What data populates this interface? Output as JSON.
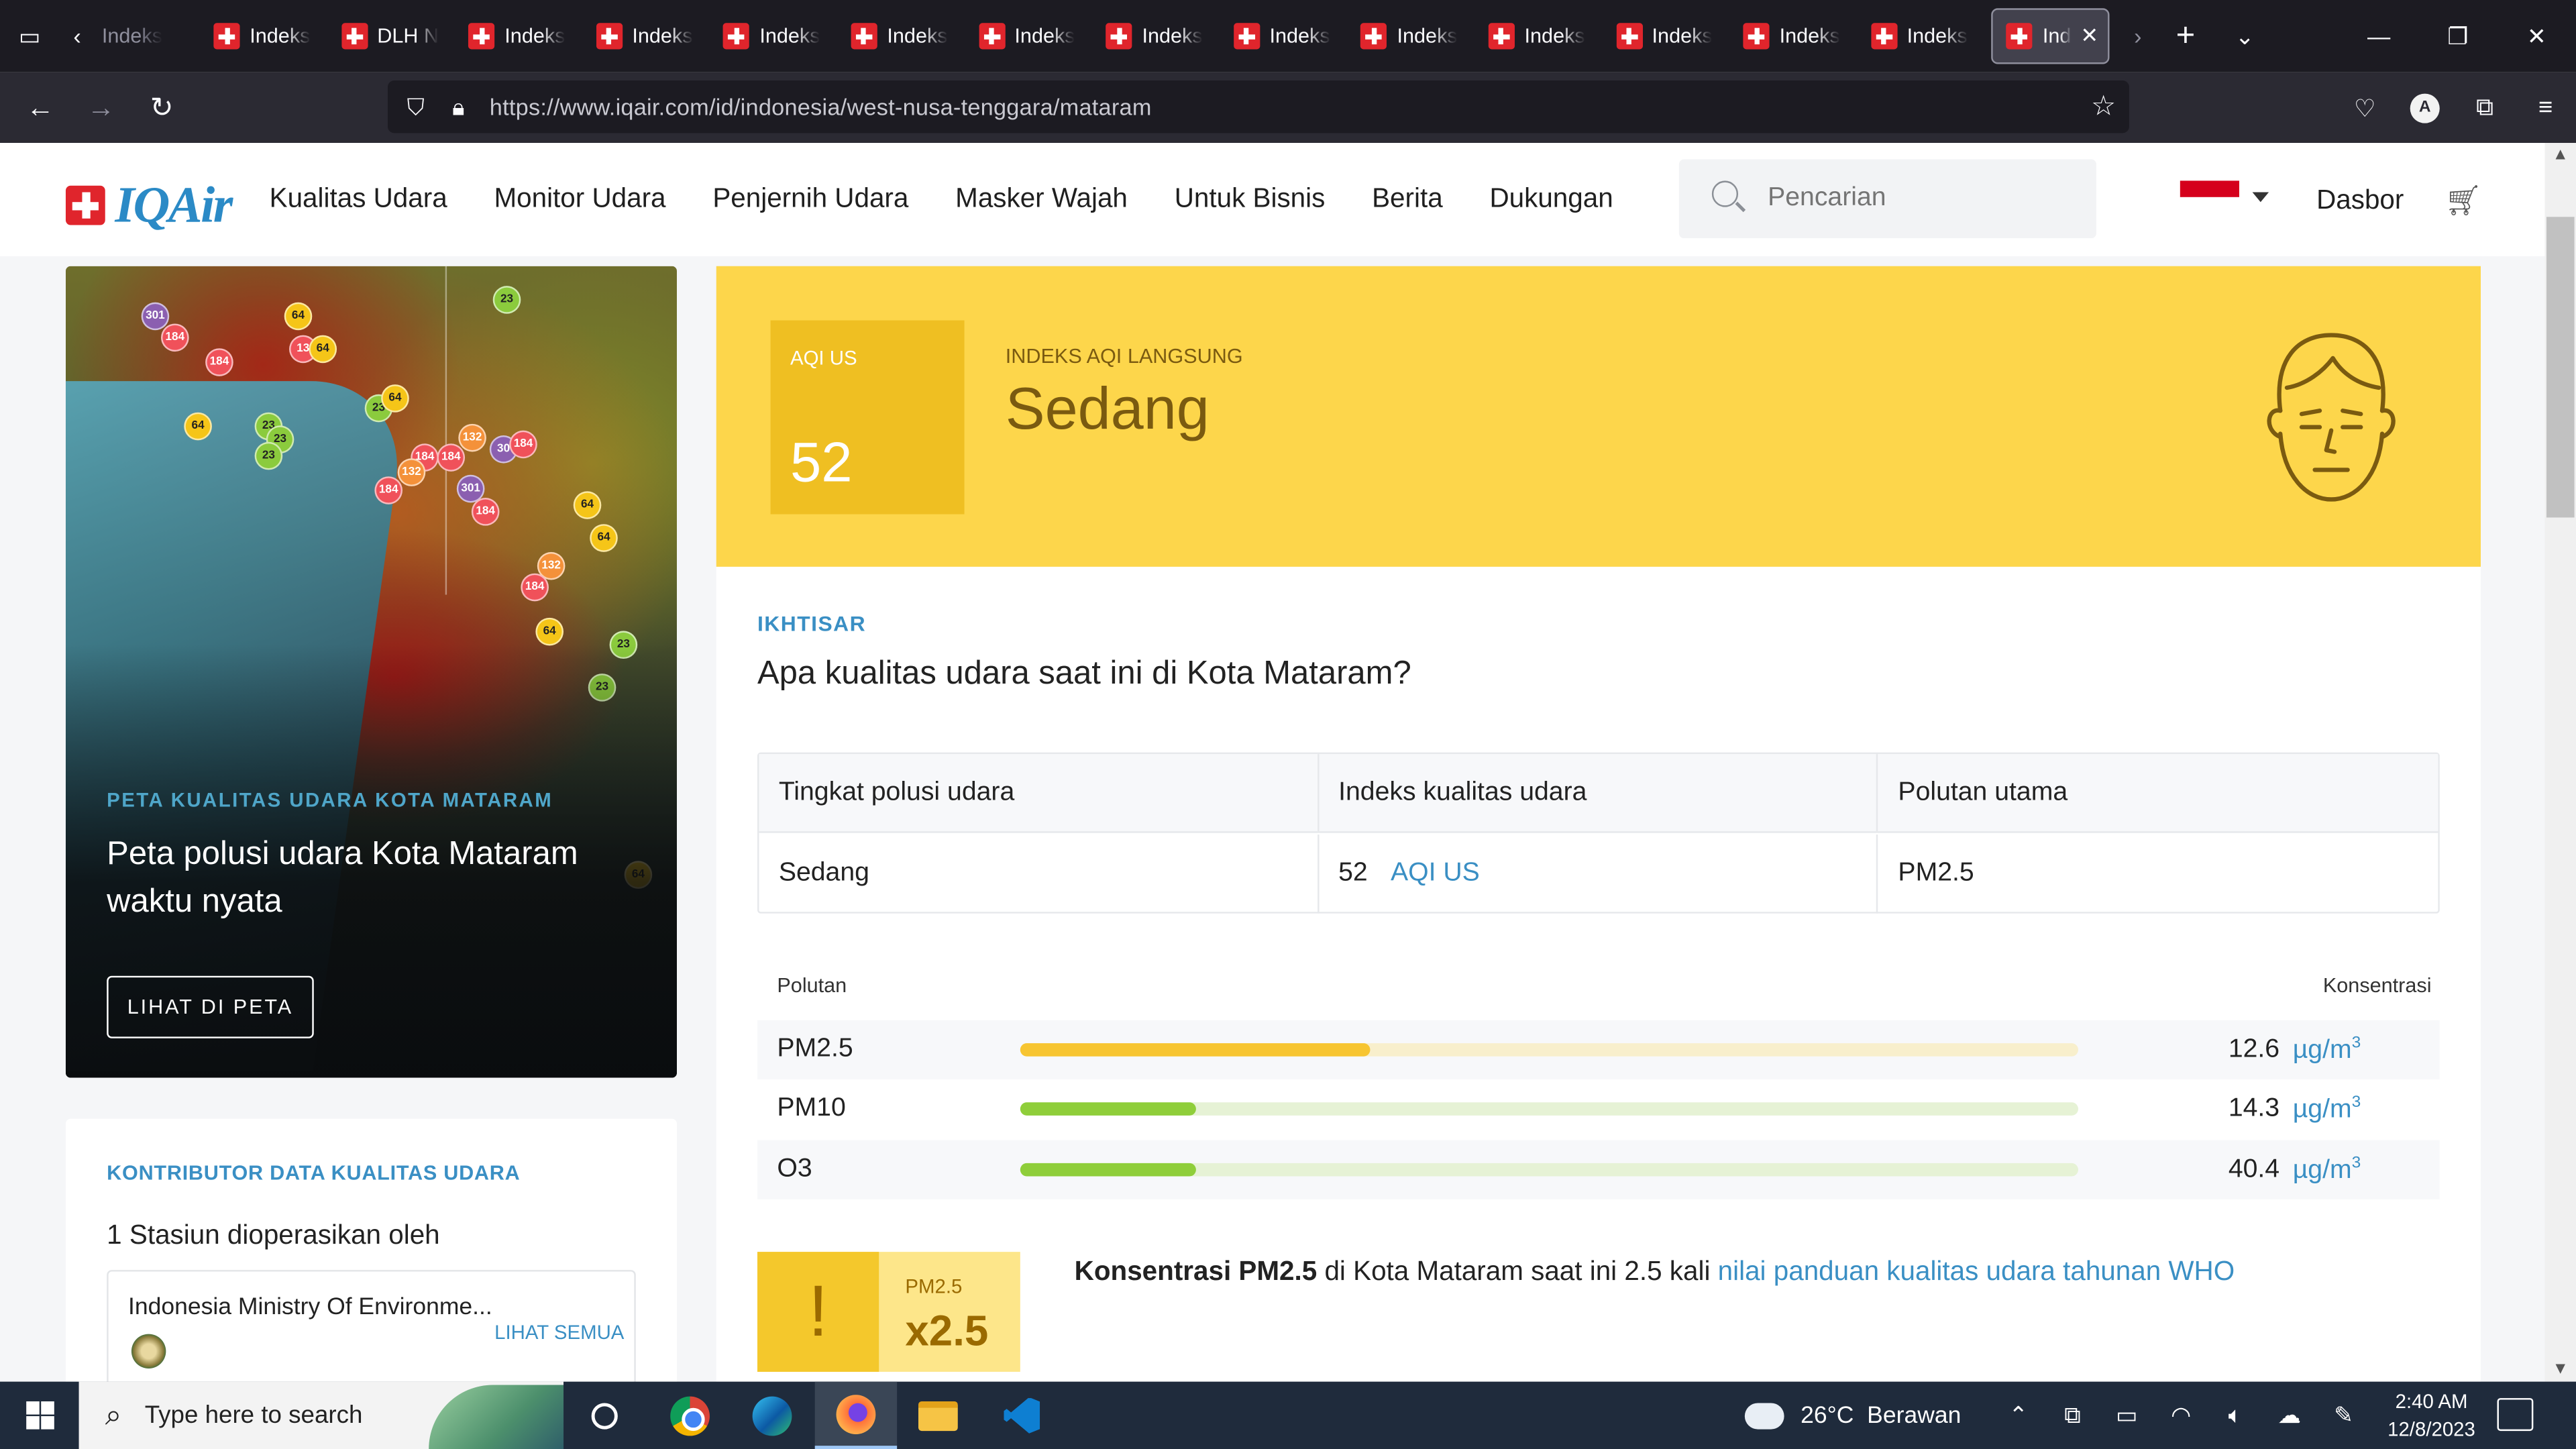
{
  "browser": {
    "tabs": [
      {
        "label": "Indeks"
      },
      {
        "label": "Indeks"
      },
      {
        "label": "DLH N"
      },
      {
        "label": "Indeks"
      },
      {
        "label": "Indeks"
      },
      {
        "label": "Indeks"
      },
      {
        "label": "Indeks"
      },
      {
        "label": "Indeks"
      },
      {
        "label": "Indeks"
      },
      {
        "label": "Indeks"
      },
      {
        "label": "Indeks"
      },
      {
        "label": "Indeks"
      },
      {
        "label": "Indeks"
      },
      {
        "label": "Indeks"
      },
      {
        "label": "Indeks"
      },
      {
        "label": "Ind",
        "active": true
      }
    ],
    "url": "https://www.iqair.com/id/indonesia/west-nusa-tenggara/mataram",
    "account_initial": "A"
  },
  "header": {
    "logo": "IQAir",
    "nav": [
      "Kualitas Udara",
      "Monitor Udara",
      "Penjernih Udara",
      "Masker Wajah",
      "Untuk Bisnis",
      "Berita",
      "Dukungan"
    ],
    "search_placeholder": "Pencarian",
    "dashboard": "Dasbor"
  },
  "map_card": {
    "kicker": "PETA KUALITAS UDARA KOTA MATARAM",
    "title": "Peta polusi udara Kota Mataram waktu nyata",
    "button": "LIHAT DI PETA",
    "markers": [
      "301",
      "184",
      "184",
      "64",
      "13",
      "64",
      "64",
      "23",
      "23",
      "23",
      "23",
      "64",
      "132",
      "184",
      "184",
      "132",
      "30",
      "184",
      "64",
      "184",
      "301",
      "184",
      "64",
      "132",
      "184",
      "64",
      "23",
      "23",
      "64",
      "23"
    ]
  },
  "contributors": {
    "kicker": "KONTRIBUTOR DATA KUALITAS UDARA",
    "subtitle": "1 Stasiun dioperasikan oleh",
    "org": "Indonesia Ministry Of Environme...",
    "see_all": "LIHAT SEMUA"
  },
  "aqi": {
    "label": "AQI US",
    "value": "52",
    "kicker": "INDEKS AQI LANGSUNG",
    "status": "Sedang",
    "color": "#fdd64b"
  },
  "overview": {
    "kicker": "IKHTISAR",
    "title": "Apa kualitas udara saat ini di Kota Mataram?",
    "table": {
      "headers": [
        "Tingkat polusi udara",
        "Indeks kualitas udara",
        "Polutan utama"
      ],
      "level": "Sedang",
      "aqi_value": "52",
      "aqi_unit": "AQI US",
      "main_pollutant": "PM2.5"
    },
    "pollutant_header": "Polutan",
    "concentration_header": "Konsentrasi",
    "pollutants": [
      {
        "name": "PM2.5",
        "value": "12.6",
        "unit": "µg/m",
        "fill": 0.33,
        "color": "#f7c531",
        "track": "#f8efcc"
      },
      {
        "name": "PM10",
        "value": "14.3",
        "unit": "µg/m",
        "fill": 0.166,
        "color": "#8fce3a",
        "track": "#e6f2d5"
      },
      {
        "name": "O3",
        "value": "40.4",
        "unit": "µg/m",
        "fill": 0.166,
        "color": "#8fce3a",
        "track": "#e6f2d5"
      }
    ],
    "warn_label": "PM2.5",
    "warn_value": "x2.5",
    "who_bold": "Konsentrasi PM2.5",
    "who_text": " di Kota Mataram saat ini 2.5 kali ",
    "who_link": "nilai panduan kualitas udara tahunan WHO"
  },
  "taskbar": {
    "search": "Type here to search",
    "weather": "26°C  Berawan",
    "time": "2:40 AM",
    "date": "12/8/2023"
  }
}
